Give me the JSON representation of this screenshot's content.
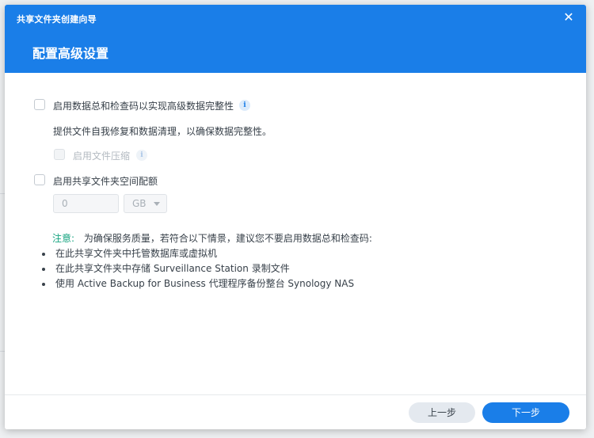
{
  "window": {
    "title": "共享文件夹创建向导",
    "close_glyph": "✕"
  },
  "step": {
    "title": "配置高级设置"
  },
  "options": {
    "checksum": {
      "label": "启用数据总和检查码以实现高级数据完整性",
      "checked": false,
      "description": "提供文件自我修复和数据清理，以确保数据完整性。"
    },
    "compression": {
      "label": "启用文件压缩",
      "checked": false,
      "disabled": true
    },
    "quota": {
      "label": "启用共享文件夹空间配额",
      "checked": false,
      "value": "0",
      "unit": "GB"
    }
  },
  "note": {
    "prefix": "注意:",
    "text": "为确保服务质量，若符合以下情景，建议您不要启用数据总和检查码:",
    "items": [
      "在此共享文件夹中托管数据库或虚拟机",
      "在此共享文件夹中存储 Surveillance Station 录制文件",
      "使用 Active Backup for Business 代理程序备份整台 Synology NAS"
    ]
  },
  "footer": {
    "prev_label": "上一步",
    "next_label": "下一步"
  },
  "icons": {
    "info": "i"
  },
  "colors": {
    "accent": "#1a7ee8",
    "note_prefix": "#14a37f"
  }
}
